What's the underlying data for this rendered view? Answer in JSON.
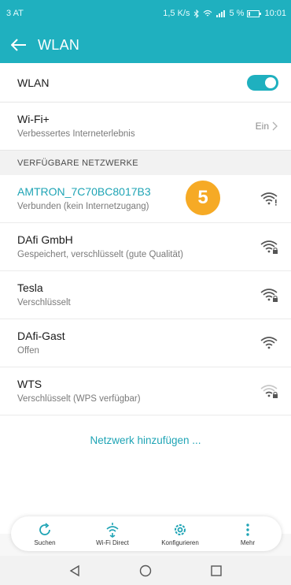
{
  "status_bar": {
    "carrier": "3 AT",
    "right_text": "1,5 K/s",
    "battery": "5 %",
    "time": "10:01"
  },
  "app_bar": {
    "title": "WLAN"
  },
  "wlan_toggle": {
    "label": "WLAN",
    "state": "on"
  },
  "wifi_plus": {
    "title": "Wi-Fi+",
    "subtitle": "Verbessertes Interneterlebnis",
    "value": "Ein"
  },
  "section_header": "VERFÜGBARE NETZWERKE",
  "networks": [
    {
      "name": "AMTRON_7C70BC8017B3",
      "status": "Verbunden (kein Internetzugang)",
      "icon": "wifi-warning-icon"
    },
    {
      "name": "DAfi GmbH",
      "status": "Gespeichert, verschlüsselt (gute Qualität)",
      "icon": "wifi-lock-icon"
    },
    {
      "name": "Tesla",
      "status": "Verschlüsselt",
      "icon": "wifi-lock-icon"
    },
    {
      "name": "DAfi-Gast",
      "status": "Offen",
      "icon": "wifi-icon"
    },
    {
      "name": "WTS",
      "status": "Verschlüsselt (WPS verfügbar)",
      "icon": "wifi-lock-weak-icon"
    }
  ],
  "badge": "5",
  "add_network": "Netzwerk hinzufügen ...",
  "bottom_tabs": [
    {
      "label": "Suchen",
      "icon": "refresh-icon"
    },
    {
      "label": "Wi-Fi Direct",
      "icon": "wifi-direct-icon"
    },
    {
      "label": "Konfigurieren",
      "icon": "gear-icon"
    },
    {
      "label": "Mehr",
      "icon": "more-vertical-icon"
    }
  ],
  "colors": {
    "accent": "#1fb0bf",
    "badge": "#f6aa25"
  }
}
